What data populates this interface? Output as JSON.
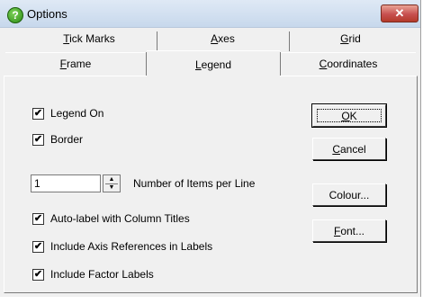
{
  "window": {
    "title": "Options",
    "close_glyph": "✕",
    "help_glyph": "?"
  },
  "tabs": {
    "back_row": [
      {
        "label": "Tick Marks",
        "mnemonic": "T",
        "rest": "ick Marks"
      },
      {
        "label": "Axes",
        "mnemonic": "A",
        "rest": "xes"
      },
      {
        "label": "Grid",
        "mnemonic": "G",
        "rest": "rid"
      }
    ],
    "front_row": [
      {
        "label": "Frame",
        "mnemonic": "F",
        "rest": "rame"
      },
      {
        "label": "Legend",
        "mnemonic": "L",
        "rest": "egend",
        "selected": true
      },
      {
        "label": "Coordinates",
        "mnemonic": "C",
        "rest": "oordinates"
      }
    ]
  },
  "options": {
    "legend_on": {
      "label": "Legend On",
      "checked": true
    },
    "border": {
      "label": "Border",
      "checked": true
    },
    "items_per_line": {
      "value": "1",
      "label": "Number of Items per Line"
    },
    "auto_label": {
      "label": "Auto-label with Column Titles",
      "checked": true
    },
    "axis_refs": {
      "label": "Include Axis References in Labels",
      "checked": true
    },
    "factor_labels": {
      "label": "Include Factor Labels",
      "checked": true
    }
  },
  "buttons": {
    "ok": {
      "mnemonic": "O",
      "rest": "K"
    },
    "cancel": {
      "mnemonic": "C",
      "rest": "ancel"
    },
    "colour": {
      "label": "Colour..."
    },
    "font": {
      "mnemonic": "F",
      "rest": "ont..."
    }
  },
  "check_glyph": "✔"
}
